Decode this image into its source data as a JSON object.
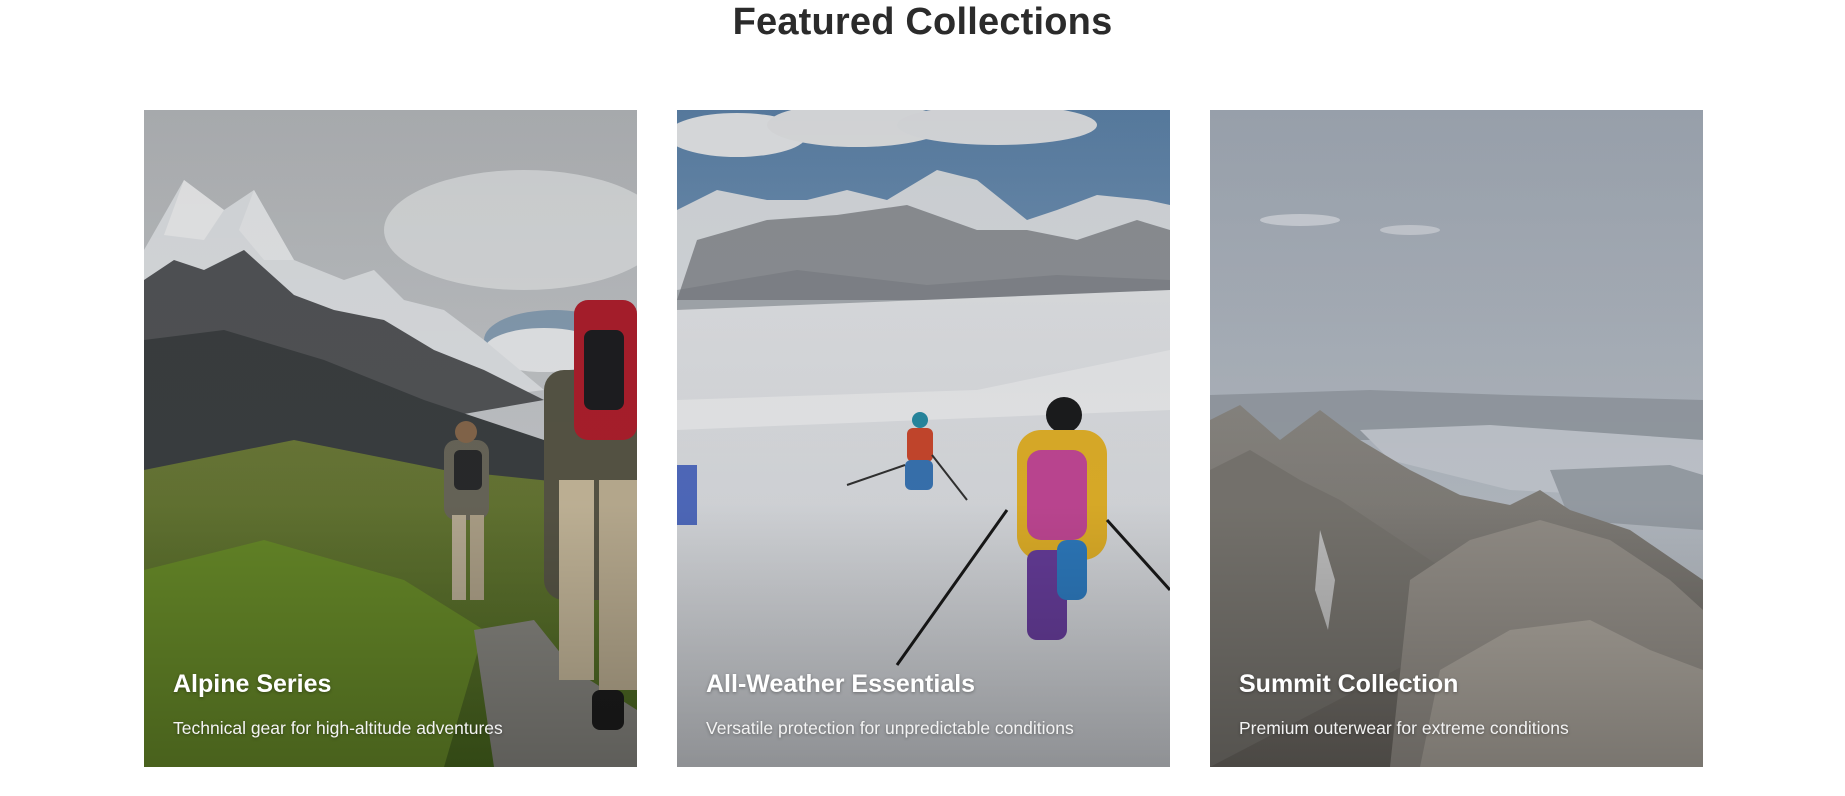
{
  "section": {
    "title": "Featured Collections"
  },
  "collections": [
    {
      "title": "Alpine Series",
      "description": "Technical gear for high-altitude adventures",
      "image": "hikers-mountain-trail-photo"
    },
    {
      "title": "All-Weather Essentials",
      "description": "Versatile protection for unpredictable conditions",
      "image": "skiers-snow-slope-photo"
    },
    {
      "title": "Summit Collection",
      "description": "Premium outerwear for extreme conditions",
      "image": "rocky-summit-lake-view-photo"
    }
  ],
  "colors": {
    "heading": "#2b2b2b",
    "caption_text": "#ffffff",
    "background": "#ffffff"
  }
}
